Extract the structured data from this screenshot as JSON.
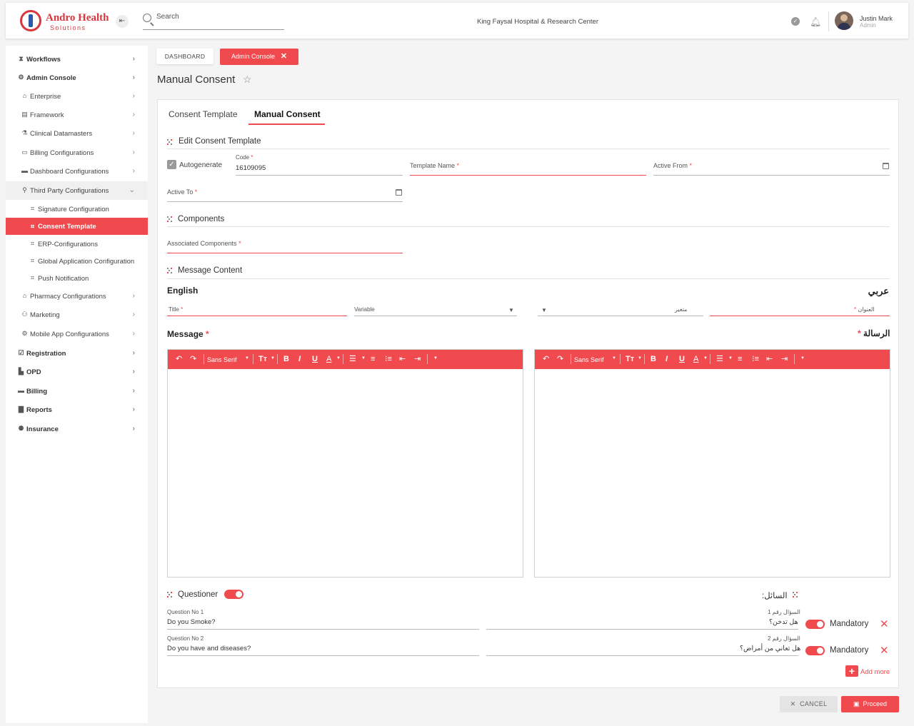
{
  "brand": {
    "title": "Andro Health",
    "subtitle": "Solutions",
    "accent": "#f04a4f"
  },
  "header": {
    "search_placeholder": "Search",
    "hospital": "King Faysal Hospital & Research Center",
    "user_name": "Justin Mark",
    "user_role": "Admin"
  },
  "sidebar": {
    "items": [
      {
        "label": "Workflows",
        "icon": "hourglass-icon"
      },
      {
        "label": "Admin Console",
        "icon": "gear-icon"
      },
      {
        "label": "Enterprise",
        "icon": "building-icon"
      },
      {
        "label": "Framework",
        "icon": "grid-icon"
      },
      {
        "label": "Clinical Datamasters",
        "icon": "flask-icon"
      },
      {
        "label": "Billing Configurations",
        "icon": "card-icon"
      },
      {
        "label": "Dashboard Configurations",
        "icon": "dashboard-icon"
      },
      {
        "label": "Third Party Configurations",
        "icon": "link-icon"
      },
      {
        "label": "Signature Configuration",
        "icon": "network-icon"
      },
      {
        "label": "Consent Template",
        "icon": "network-icon"
      },
      {
        "label": "ERP-Configurations",
        "icon": "network-icon"
      },
      {
        "label": "Global Application Configuration",
        "icon": "network-icon"
      },
      {
        "label": "Push Notification",
        "icon": "network-icon"
      },
      {
        "label": "Pharmacy Configurations",
        "icon": "pharmacy-icon"
      },
      {
        "label": "Marketing",
        "icon": "share-icon"
      },
      {
        "label": "Mobile App Configurations",
        "icon": "gear-icon"
      },
      {
        "label": "Registration",
        "icon": "check-square-icon"
      },
      {
        "label": "OPD",
        "icon": "clinic-icon"
      },
      {
        "label": "Billing",
        "icon": "wallet-icon"
      },
      {
        "label": "Reports",
        "icon": "document-icon"
      },
      {
        "label": "Insurance",
        "icon": "family-icon"
      }
    ]
  },
  "breadcrumb": {
    "dashboard": "DASHBOARD",
    "current": "Admin Console"
  },
  "page_title": "Manual Consent",
  "tabs": {
    "consent_template": "Consent Template",
    "manual_consent": "Manual Consent"
  },
  "form": {
    "edit_section": "Edit Consent Template",
    "autogenerate": "Autogenerate",
    "code_label": "Code",
    "code_value": "16109095",
    "template_name_label": "Template Name",
    "active_from_label": "Active From",
    "active_to_label": "Active To",
    "required_mark": "*",
    "components_section": "Components",
    "associated_components_label": "Associated Components",
    "message_section": "Message Content",
    "english_label": "English",
    "arabic_label": "عربي",
    "title_label": "Title",
    "variable_label": "Variable",
    "variable_ar_label": "متغير",
    "title_ar_label": "العنوان",
    "message_label": "Message",
    "message_ar_label": "الرسالة"
  },
  "editor_toolbar": {
    "font": "Sans Serif",
    "bold": "B",
    "italic": "I",
    "underline": "U",
    "color": "A"
  },
  "questioner": {
    "label": "Questioner",
    "ar_label": "السائل:",
    "enabled": true,
    "questions": [
      {
        "label": "Question No 1",
        "value": "Do you Smoke?",
        "ar_label": "السؤال رقم 1",
        "ar_value": "هل تدخن؟",
        "mandatory": true
      },
      {
        "label": "Question No 2",
        "value": "Do you have and diseases?",
        "ar_label": "السؤال رقم 2",
        "ar_value": "هل تعاني من أمراض؟",
        "mandatory": true
      }
    ],
    "mandatory_label": "Mandatory",
    "add_more": "Add more"
  },
  "actions": {
    "cancel": "CANCEL",
    "proceed": "Proceed"
  }
}
